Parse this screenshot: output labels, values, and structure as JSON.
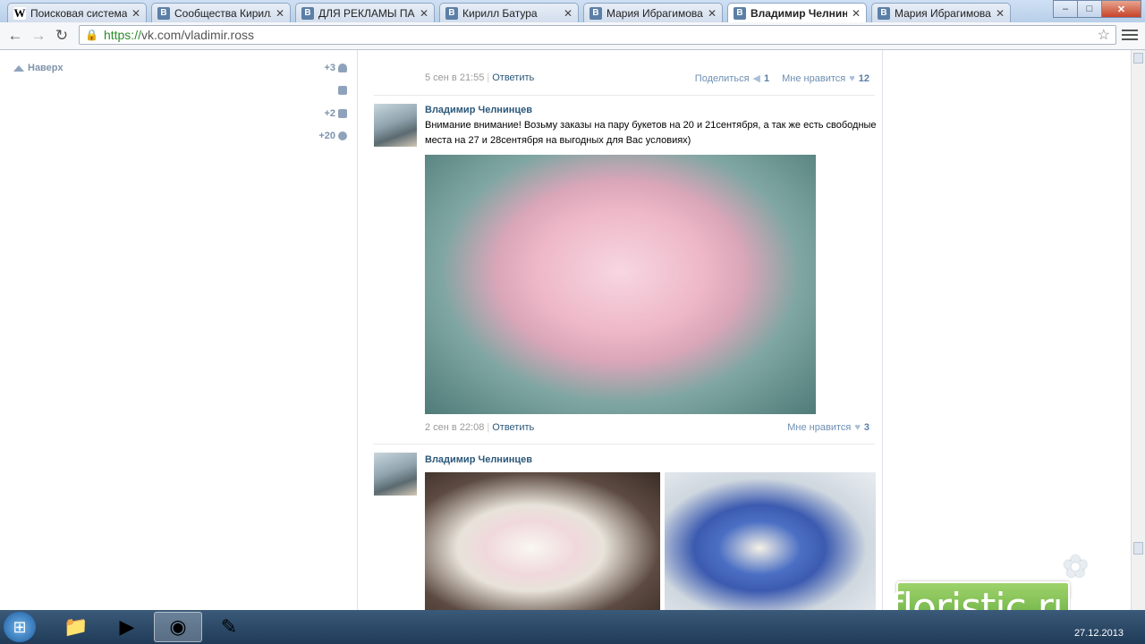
{
  "browser": {
    "tabs": [
      {
        "favicon": "W",
        "favicon_type": "w",
        "label": "Поисковая система W"
      },
      {
        "favicon": "В",
        "favicon_type": "vk",
        "label": "Сообщества Кирилл"
      },
      {
        "favicon": "В",
        "favicon_type": "vk",
        "label": "ДЛЯ РЕКЛАМЫ ПАРТ"
      },
      {
        "favicon": "В",
        "favicon_type": "vk",
        "label": "Кирилл Батура"
      },
      {
        "favicon": "В",
        "favicon_type": "vk",
        "label": "Мария Ибрагимова"
      },
      {
        "favicon": "В",
        "favicon_type": "vk",
        "label": "Владимир Челнинцев",
        "active": true
      },
      {
        "favicon": "В",
        "favicon_type": "vk",
        "label": "Мария Ибрагимова"
      }
    ],
    "tab_close_glyph": "✕",
    "window_buttons": {
      "minimize": "‒",
      "maximize": "□",
      "close": "✕"
    },
    "nav": {
      "back": "←",
      "forward": "→",
      "reload": "↻"
    },
    "url_scheme": "https://",
    "url_rest": "vk.com/vladimir.ross",
    "icons": [
      "lock-icon",
      "star-icon",
      "menu-icon"
    ]
  },
  "left_rail": {
    "up_label": "Наверх",
    "counters": [
      {
        "value": "+3",
        "icon": "user-icon"
      },
      {
        "value": "",
        "icon": "mail-icon"
      },
      {
        "value": "+2",
        "icon": "comment-icon"
      },
      {
        "value": "+20",
        "icon": "gear-icon"
      }
    ]
  },
  "posts": [
    {
      "date": "5 сен в 21:55",
      "reply_label": "Ответить",
      "share_label": "Поделиться",
      "share_count": "1",
      "like_label": "Мне нравится",
      "like_count": "12"
    },
    {
      "author": "Владимир Челнинцев",
      "text": "Внимание внимание! Возьму заказы на пару букетов на 20 и 21сентября, а так же есть свободные места на 27 и 28сентября на выгодных для Вас условиях)",
      "date": "2 сен в 22:08",
      "reply_label": "Ответить",
      "like_label": "Мне нравится",
      "like_count": "3"
    },
    {
      "author": "Владимир Челнинцев"
    }
  ],
  "watermark": {
    "text": "floristic.ru"
  },
  "taskbar": {
    "apps": [
      "explorer-icon",
      "media-player-icon",
      "chrome-icon",
      "paint-icon"
    ],
    "date": "27.12.2013"
  },
  "colors": {
    "vk_link": "#2b587a",
    "vk_meta": "#999999",
    "accent": "#5b7fa6"
  }
}
